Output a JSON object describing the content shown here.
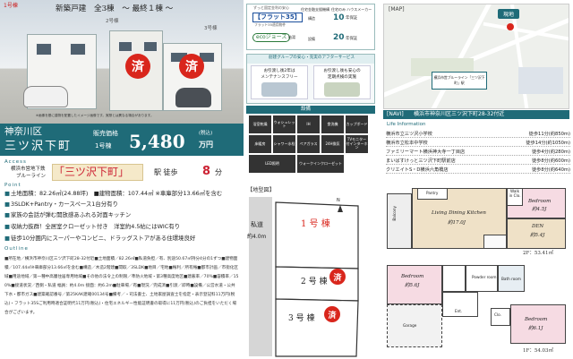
{
  "photo": {
    "unit1_tag": "1号棟",
    "headline": "新築戸建　全3棟　～ 最終１棟 ～",
    "unit2_tag": "2号棟",
    "unit3_tag": "3号棟",
    "sold_mark": "済",
    "caption": "※画像を基に建物を配置したイメージ画像です。実際とは異なる場合があります。"
  },
  "price": {
    "area": "神奈川区",
    "place": "三ツ沢下町",
    "label": "販売価格",
    "unit": "1号棟",
    "value": "5,480",
    "suffix": "万円",
    "tax": "(税込)"
  },
  "access": {
    "heading": "Access",
    "line": "横浜市営地下鉄",
    "line2": "ブルーライン",
    "station": "「三ツ沢下町」",
    "walk_label": "駅 徒歩",
    "walk_min": "8",
    "walk_unit": "分"
  },
  "points": {
    "heading": "Point",
    "items": [
      "土地面積：82.26㎡(24.88坪)　■建物面積：107.44㎡ ※車庫部分13.66㎡を含む",
      "3SLDK+Pantry・カースペース1台分有り",
      "家族の会話が弾む開放感あふれる対面キッチン",
      "収納力抜群！全居室クローゼット付き　洋室約4.5帖にはWIC有り",
      "徒歩10分圏内にスーパーやコンビニ、ドラッグストアがある住環境良好"
    ]
  },
  "outline": {
    "heading": "Outline",
    "text": "■所在地／横浜市神奈川区三ツ沢下町28-32付近■土地面積／82.26㎡■私道負担／有、別途50.67㎡持分4分の1ずつ■建物面積／107.44㎡※車庫部分13.66㎡を含む■構造／木造2階建■間取／3SLDK■地目／宅地■権利／所有権■都市計画／市街化区域■用途地域／第一種中高層住居専用地域■その他の法令上の制限／準防火地域・第3種高度地区■建蔽率／70%■容積率／150%■接道状況／西側・私道 幅員：約4.0m 接面：約6.2m■駐車場／有■現況／完成済■引渡／即時■設備／公営水道・公共下水・都市ガス■建築確認番号／第25KAK建確00134号■備考／・司法書士、土地家屋調査士を指定・表示登記料11万円(税込)・フラット35Sご利用時適合証明代11万円(税込)・住宅エネルギー性能証明書の取得に11万円(税込)のご負担をいただく場合がございます。"
  },
  "flat35": {
    "pre": "ずっと固定金利の安心",
    "brand": "【フラット35】",
    "sub": "フラット35適用物件",
    "flag": "住宅金融支援機構",
    "house_label": "住宅のみ ハウスメーカー",
    "years_label": "構造",
    "years": "10",
    "years_unit": "年保証",
    "eco_logo": "ecoジョーズ",
    "eco_label": "給湯",
    "term_label": "設備",
    "term": "20",
    "term_unit": "年保証"
  },
  "after": {
    "heading": "創建グループの安心・充実のアフターサービス",
    "item1": "お引渡し後2年は\nメンテナンスフリー",
    "item2": "お引渡し後も安心の\n定期点検の実施",
    "equip_heading": "設備"
  },
  "equipment": [
    "浴室乾燥",
    "ウォシュレット",
    "IH",
    "食洗機",
    "カップボード",
    "床暖房",
    "シャワー水栓",
    "ペアガラス",
    "24H換気",
    "TVモニター付インターホン",
    "LED照明",
    "ウォークインクローゼット"
  ],
  "map": {
    "heading": "[MAP]",
    "site_tag": "現地",
    "navi_label": "[NAVI]",
    "navi_addr": "横浜市神奈川区三ツ沢下町28-32付近",
    "marker": "横浜市営ブルーライン「三ツ沢下町」駅",
    "life_heading": "Life Information"
  },
  "life": [
    {
      "name": "横浜市立三ツ沢小学校",
      "dist": "徒歩11分(約850m)"
    },
    {
      "name": "横浜市立松本中学校",
      "dist": "徒歩14分(約1050m)"
    },
    {
      "name": "ファミリーマート横浜神大寺一丁目店",
      "dist": "徒歩4分(約280m)"
    },
    {
      "name": "まいばすけっと三ツ沢下町駅前店",
      "dist": "徒歩8分(約600m)"
    },
    {
      "name": "クリエイトS・D横浜六角橋店",
      "dist": "徒歩8分(約640m)"
    }
  ],
  "site": {
    "heading": "【地型図】",
    "road_label": "私道",
    "road_width": "約4.0m",
    "lot1": "1 号 棟",
    "lot2": "2 号 棟",
    "lot3": "3 号 棟",
    "north": "N"
  },
  "plan": {
    "pantry": "Pantry",
    "wic": "Walk in Clo.",
    "bedroom1": "Bedroom",
    "bedroom1_size": "約4.5J",
    "ldk": "Living Dining Kitchen",
    "ldk_size": "約17.0J",
    "den": "DEN",
    "den_size": "約5.4J",
    "balcony": "Balcony",
    "floor2": "2F：53.41㎡",
    "bedroom2": "Bedroom",
    "bedroom2_size": "約5.6J",
    "bedroom3": "Bedroom",
    "bedroom3_size": "約6.1J",
    "powder": "Powder room",
    "bath": "Bath room",
    "ent": "Ent.",
    "garage": "Garage",
    "clo": "Clo.",
    "floor1": "1F：54.03㎡"
  }
}
